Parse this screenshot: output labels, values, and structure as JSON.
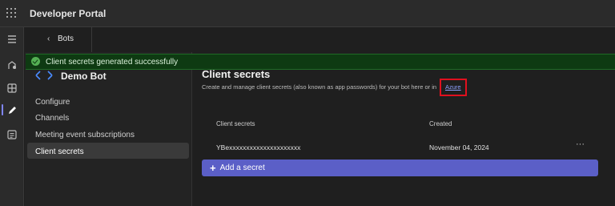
{
  "app": {
    "title": "Developer Portal"
  },
  "nav": {
    "back_label": "Bots",
    "bot_name": "Demo Bot",
    "items": [
      {
        "label": "Configure"
      },
      {
        "label": "Channels"
      },
      {
        "label": "Meeting event subscriptions"
      },
      {
        "label": "Client secrets",
        "active": true
      }
    ]
  },
  "toast": {
    "message": "Client secrets generated successfully",
    "color": "#0e3a12"
  },
  "main": {
    "title": "Client secrets",
    "description": "Create and manage client secrets (also known as app passwords) for your bot here or in",
    "link": "Azure",
    "table": {
      "headers": [
        "Client secrets",
        "Created"
      ],
      "rows": [
        {
          "secret": "YBexxxxxxxxxxxxxxxxxxxxx",
          "created": "November 04, 2024",
          "more": "···"
        }
      ]
    },
    "add_button": {
      "icon": "+",
      "label": "Add a secret"
    }
  },
  "rail_icons": [
    "menu-icon",
    "activity-icon",
    "apps-icon",
    "edit-icon",
    "calendar-icon"
  ],
  "colors": {
    "accent": "#5b5fc7",
    "highlight": "#e0101e",
    "success": "#54b054"
  }
}
